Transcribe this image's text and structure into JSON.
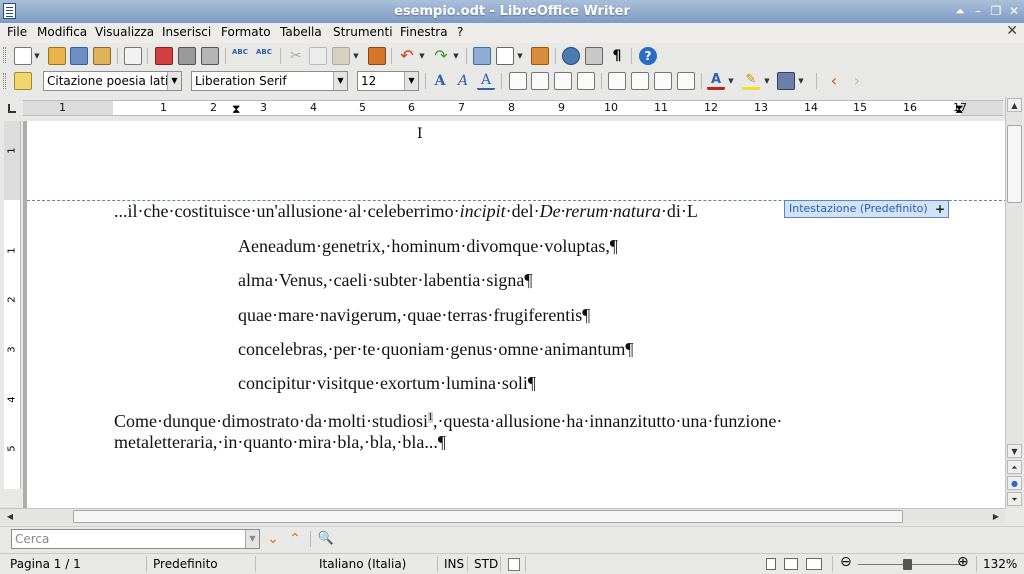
{
  "window": {
    "title": "esempio.odt - LibreOffice Writer"
  },
  "menubar": {
    "items": [
      "File",
      "Modifica",
      "Visualizza",
      "Inserisci",
      "Formato",
      "Tabella",
      "Strumenti",
      "Finestra",
      "?"
    ]
  },
  "formatting": {
    "paragraph_style": "Citazione poesia latir",
    "font_name": "Liberation Serif",
    "font_size": "12"
  },
  "ruler": {
    "numbers": [
      "1",
      "1",
      "2",
      "3",
      "4",
      "5",
      "6",
      "7",
      "8",
      "9",
      "10",
      "11",
      "12",
      "13",
      "14",
      "15",
      "16",
      "17"
    ]
  },
  "vruler": {
    "numbers": [
      "1",
      "1",
      "2",
      "3",
      "4",
      "5"
    ]
  },
  "header_tag": {
    "label": "Intestazione (Predefinito)",
    "plus": "+"
  },
  "document": {
    "intro_a": "...il·che·costituisce·un'allusione·al·celeberrimo·",
    "intro_incipit": "incipit",
    "intro_b": "·del·",
    "intro_title": "De·rerum·natura",
    "intro_c": "·di·L",
    "verses": [
      "Aeneadum·genetrix,·hominum·divomque·voluptas,¶",
      "alma·Venus,·caeli·subter·labentia·signa¶",
      "quae·mare·navigerum,·quae·terras·frugiferentis¶",
      "concelebras,·per·te·quoniam·genus·omne·animantum¶",
      "concipitur·visitque·exortum·lumina·soli¶"
    ],
    "para_a": "Come·dunque·dimostrato·da·molti·studiosi",
    "footnote_ref": "1",
    "para_b": ",·questa·allusione·ha·innanzitutto·una·funzione·",
    "para_line2": "metaletteraria,·in·quanto·mira·bla,·bla,·bla...¶"
  },
  "findbar": {
    "placeholder": "Cerca"
  },
  "statusbar": {
    "page": "Pagina 1 / 1",
    "page_style": "Predefinito",
    "language": "Italiano (Italia)",
    "insert_mode": "INS",
    "selection_mode": "STD",
    "zoom": "132%"
  },
  "colors": {
    "header_accent": "#5b86c6",
    "title_bar": "#7d9bc3"
  }
}
